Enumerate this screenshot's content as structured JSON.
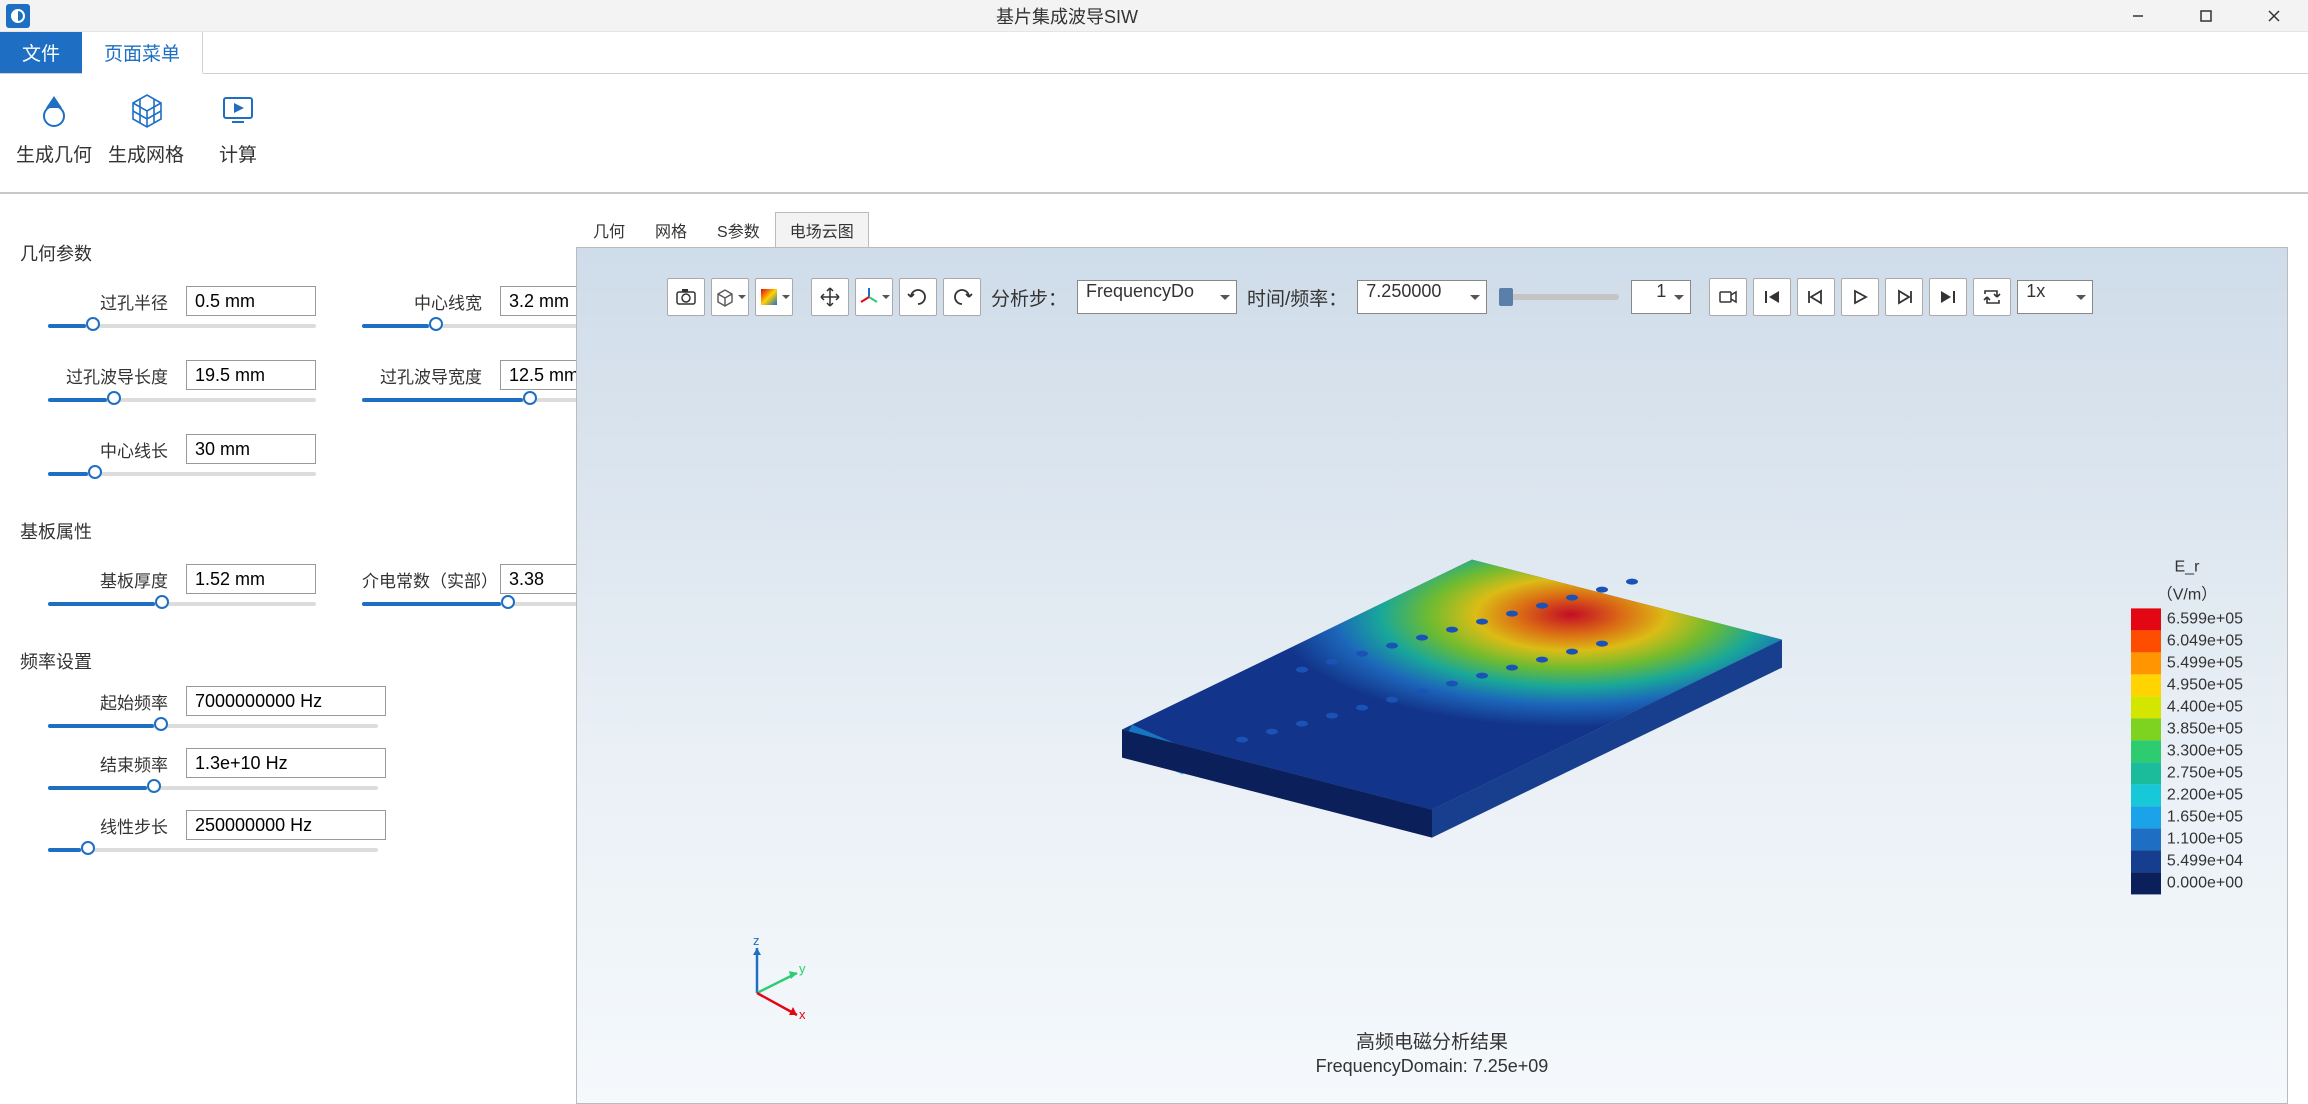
{
  "window": {
    "title": "基片集成波导SIW"
  },
  "menu": {
    "file": "文件",
    "page": "页面菜单"
  },
  "ribbon": {
    "geom": "生成几何",
    "mesh": "生成网格",
    "calc": "计算"
  },
  "sidebar": {
    "sections": {
      "geom": "几何参数",
      "sub": "基板属性",
      "freq": "频率设置"
    },
    "params": {
      "via_radius": {
        "label": "过孔半径",
        "value": "0.5 mm",
        "pct": 14
      },
      "center_width": {
        "label": "中心线宽",
        "value": "3.2 mm",
        "pct": 25
      },
      "wg_len": {
        "label": "过孔波导长度",
        "value": "19.5 mm",
        "pct": 22
      },
      "wg_wid": {
        "label": "过孔波导宽度",
        "value": "12.5 mm",
        "pct": 60
      },
      "center_len": {
        "label": "中心线长",
        "value": "30 mm",
        "pct": 15
      },
      "sub_thk": {
        "label": "基板厚度",
        "value": "1.52 mm",
        "pct": 40
      },
      "eps": {
        "label": "介电常数（实部）",
        "value": "3.38",
        "pct": 52
      },
      "fstart": {
        "label": "起始频率",
        "value": "7000000000 Hz",
        "pct": 32
      },
      "fend": {
        "label": "结束频率",
        "value": "1.3e+10 Hz",
        "pct": 30
      },
      "fstep": {
        "label": "线性步长",
        "value": "250000000 Hz",
        "pct": 10
      }
    }
  },
  "viewtabs": {
    "geom": "几何",
    "mesh": "网格",
    "sparam": "S参数",
    "efield": "电场云图"
  },
  "ctoolbar": {
    "analysis_step": "分析步：",
    "analysis_value": "FrequencyDo",
    "time_freq": "时间/频率：",
    "time_value": "7.250000",
    "frame": "1",
    "rate": "1x"
  },
  "caption": {
    "line1": "高频电磁分析结果",
    "line2": "FrequencyDomain: 7.25e+09"
  },
  "legend": {
    "title1": "E_r",
    "title2": "（V/m）",
    "colors": [
      "#e30613",
      "#ff4d00",
      "#ff9500",
      "#ffd400",
      "#d4e600",
      "#7ed321",
      "#2ecc71",
      "#1abc9c",
      "#17c9d8",
      "#1aa3e8",
      "#1e6fc3",
      "#153f8e",
      "#0b205a"
    ],
    "ticks": [
      "6.599e+05",
      "6.049e+05",
      "5.499e+05",
      "4.950e+05",
      "4.400e+05",
      "3.850e+05",
      "3.300e+05",
      "2.750e+05",
      "2.200e+05",
      "1.650e+05",
      "1.100e+05",
      "5.499e+04",
      "0.000e+00"
    ]
  },
  "chart_data": {
    "type": "heatmap",
    "title": "高频电磁分析结果",
    "subtitle": "FrequencyDomain: 7.25e+09",
    "field": "E_r",
    "unit": "V/m",
    "range": [
      0.0,
      659900.0
    ],
    "colorbar_ticks": [
      659900.0,
      604900.0,
      549900.0,
      495000.0,
      440000.0,
      385000.0,
      330000.0,
      275000.0,
      220000.0,
      165000.0,
      110000.0,
      54990.0,
      0.0
    ]
  }
}
